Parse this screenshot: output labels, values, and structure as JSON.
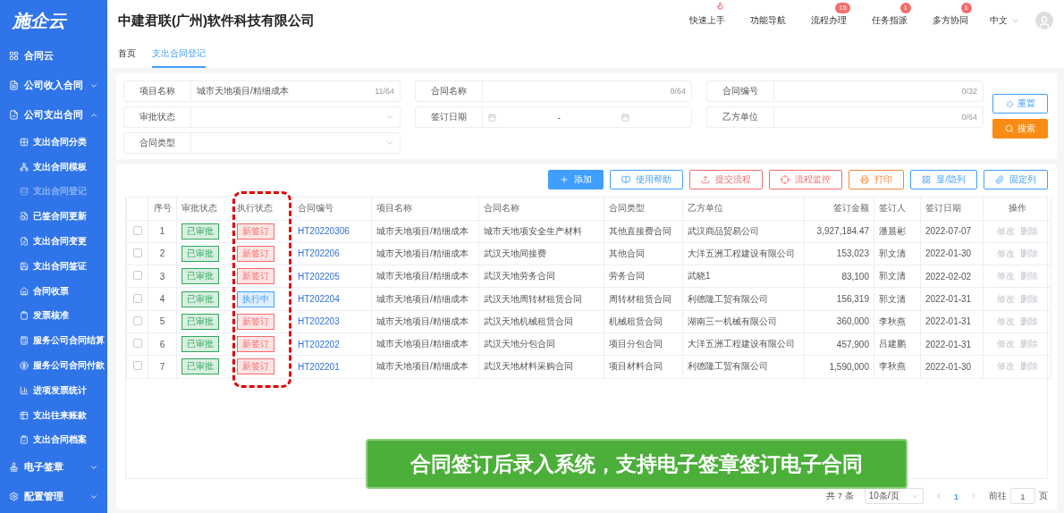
{
  "sidebar": {
    "logo": "施企云",
    "items": [
      {
        "label": "合同云"
      },
      {
        "label": "公司收入合同",
        "expanded": false
      },
      {
        "label": "公司支出合同",
        "expanded": true,
        "children": [
          {
            "label": "支出合同分类",
            "selected": false
          },
          {
            "label": "支出合同模板",
            "selected": false
          },
          {
            "label": "支出合同登记",
            "selected": true
          },
          {
            "label": "已签合同更新",
            "selected": false
          },
          {
            "label": "支出合同变更",
            "selected": false
          },
          {
            "label": "支出合同签证",
            "selected": false
          },
          {
            "label": "合同收票",
            "selected": false
          },
          {
            "label": "发票核准",
            "selected": false
          },
          {
            "label": "服务公司合同结算",
            "selected": false
          },
          {
            "label": "服务公司合同付款",
            "selected": false
          },
          {
            "label": "进项发票统计",
            "selected": false
          },
          {
            "label": "支出往来账款",
            "selected": false
          },
          {
            "label": "支出合同档案",
            "selected": false
          }
        ]
      },
      {
        "label": "电子签章",
        "expanded": false
      },
      {
        "label": "配置管理",
        "expanded": false
      }
    ]
  },
  "header": {
    "title": "中建君联(广州)软件科技有限公司",
    "nav": [
      {
        "label": "快速上手",
        "hot": true
      },
      {
        "label": "功能导航"
      },
      {
        "label": "流程办理",
        "badge": "15"
      },
      {
        "label": "任务指派",
        "badge": "1"
      },
      {
        "label": "多方协同",
        "badge": "1"
      }
    ],
    "language": "中文"
  },
  "tabs": [
    {
      "label": "首页",
      "selected": false
    },
    {
      "label": "支出合同登记",
      "selected": true
    }
  ],
  "filters": [
    {
      "label": "项目名称",
      "kind": "text",
      "value": "城市天地项目/精细成本",
      "counter": "11/64"
    },
    {
      "label": "合同名称",
      "kind": "text",
      "counter": "0/64"
    },
    {
      "label": "合同编号",
      "kind": "text",
      "counter": "0/32"
    },
    {
      "label": "审批状态",
      "kind": "select"
    },
    {
      "label": "签订日期",
      "kind": "daterange",
      "separator": "-"
    },
    {
      "label": "乙方单位",
      "kind": "text",
      "counter": "0/64"
    },
    {
      "label": "合同类型",
      "kind": "select"
    }
  ],
  "filter_buttons": {
    "reset": "重置",
    "search": "搜索"
  },
  "toolbar": [
    {
      "label": "添加",
      "kind": "add",
      "color": "#409eff"
    },
    {
      "label": "使用帮助",
      "kind": "help",
      "color": "#409eff"
    },
    {
      "label": "提交流程",
      "kind": "submit",
      "color": "#f56c6c"
    },
    {
      "label": "流程监控",
      "kind": "monitor",
      "color": "#f56c6c"
    },
    {
      "label": "打印",
      "kind": "print",
      "color": "#f5893a"
    },
    {
      "label": "显/隐列",
      "kind": "columns",
      "color": "#409eff"
    },
    {
      "label": "固定列",
      "kind": "pin",
      "color": "#409eff"
    }
  ],
  "table": {
    "columns": [
      "序号",
      "审批状态",
      "执行状态",
      "合同编号",
      "项目名称",
      "合同名称",
      "合同类型",
      "乙方单位",
      "签订金额",
      "签订人",
      "签订日期",
      "操作"
    ],
    "rows": [
      {
        "checked": false,
        "no": "1",
        "approval": "已审批",
        "exec": {
          "text": "新签订",
          "color": "#f56c6c"
        },
        "code": "HT20220306",
        "project": "城市天地项目/精细成本",
        "name": "城市天地项安全生产材料",
        "type": "其他直接费合同",
        "party": "武汉商品贸易公司",
        "amount": "3,927,184.47",
        "signer": "潘晨彬",
        "date": "2022-07-07",
        "actions": [
          {
            "label": "修改",
            "disabled": true
          },
          {
            "label": "删除",
            "disabled": true
          }
        ]
      },
      {
        "checked": false,
        "no": "2",
        "approval": "已审批",
        "exec": {
          "text": "新签订",
          "color": "#f56c6c"
        },
        "code": "HT202206",
        "project": "城市天地项目/精细成本",
        "name": "武汉天地间接费",
        "type": "其他合同",
        "party": "大洋五洲工程建设有限公司",
        "amount": "153,023",
        "signer": "郭文清",
        "date": "2022-01-30",
        "actions": [
          {
            "label": "修改",
            "disabled": true
          },
          {
            "label": "删除",
            "disabled": true
          }
        ]
      },
      {
        "checked": false,
        "no": "3",
        "approval": "已审批",
        "exec": {
          "text": "新签订",
          "color": "#f56c6c"
        },
        "code": "HT202205",
        "project": "城市天地项目/精细成本",
        "name": "武汉天地劳务合同",
        "type": "劳务合同",
        "party": "武晓1",
        "amount": "83,100",
        "signer": "郭文清",
        "date": "2022-02-02",
        "actions": [
          {
            "label": "修改",
            "disabled": true
          },
          {
            "label": "删除",
            "disabled": true
          }
        ]
      },
      {
        "checked": false,
        "no": "4",
        "approval": "已审批",
        "exec": {
          "text": "执行中",
          "color": "#409eff"
        },
        "code": "HT202204",
        "project": "城市天地项目/精细成本",
        "name": "武汉天地周转材租赁合同",
        "type": "周转材租赁合同",
        "party": "利德隆工贸有限公司",
        "amount": "156,319",
        "signer": "郭文清",
        "date": "2022-01-31",
        "actions": [
          {
            "label": "修改",
            "disabled": true
          },
          {
            "label": "删除",
            "disabled": true
          }
        ]
      },
      {
        "checked": false,
        "no": "5",
        "approval": "已审批",
        "exec": {
          "text": "新签订",
          "color": "#f56c6c"
        },
        "code": "HT202203",
        "project": "城市天地项目/精细成本",
        "name": "武汉天地机械租赁合同",
        "type": "机械租赁合同",
        "party": "湖南三一机械有限公司",
        "amount": "360,000",
        "signer": "李秋燕",
        "date": "2022-01-31",
        "actions": [
          {
            "label": "修改",
            "disabled": true
          },
          {
            "label": "删除",
            "disabled": true
          }
        ]
      },
      {
        "checked": false,
        "no": "6",
        "approval": "已审批",
        "exec": {
          "text": "新签订",
          "color": "#f56c6c"
        },
        "code": "HT202202",
        "project": "城市天地项目/精细成本",
        "name": "武汉天地分包合同",
        "type": "项目分包合同",
        "party": "大洋五洲工程建设有限公司",
        "amount": "457,900",
        "signer": "吕建鹏",
        "date": "2022-01-31",
        "actions": [
          {
            "label": "修改",
            "disabled": true
          },
          {
            "label": "删除",
            "disabled": true
          }
        ]
      },
      {
        "checked": false,
        "no": "7",
        "approval": "已审批",
        "exec": {
          "text": "新签订",
          "color": "#f56c6c"
        },
        "code": "HT202201",
        "project": "城市天地项目/精细成本",
        "name": "武汉天地材料采购合同",
        "type": "项目材料合同",
        "party": "利德隆工贸有限公司",
        "amount": "1,590,000",
        "signer": "李秋燕",
        "date": "2022-01-30",
        "actions": [
          {
            "label": "修改",
            "disabled": true
          },
          {
            "label": "删除",
            "disabled": true
          }
        ]
      }
    ]
  },
  "banner": "合同签订后录入系统，支持电子签章签订电子合同",
  "pagination": {
    "total": "共 7 条",
    "page_size": "10条/页",
    "pages": [
      {
        "label": "1",
        "selected": true
      }
    ],
    "goto": "前往",
    "goto_value": "1",
    "unit": "页"
  }
}
